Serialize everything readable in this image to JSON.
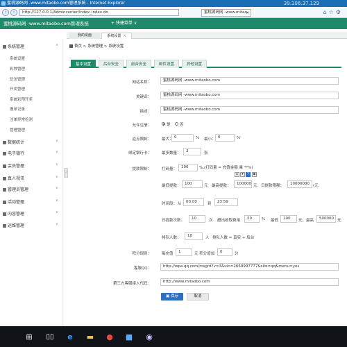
{
  "browser": {
    "title": "蜜桃源码网 -www.mitaobo.com管理系统 - Internet Explorer",
    "ip": "39.106.37.129",
    "address": "http://127.0.0.1/Admincenter/Index_index.do",
    "tab_label": "蜜桃源码网 -www.mitao..."
  },
  "header": {
    "title": "蜜桃源码网 -www.mitaobo.com管理系统",
    "quick_menu": "+ 快捷菜单 ∨"
  },
  "page_tabs": [
    {
      "label": "我的桌面"
    },
    {
      "label": "系统设置"
    }
  ],
  "sidebar": {
    "groups": [
      {
        "label": "系统管理",
        "items": [
          "系统设置",
          "彩种管理",
          "玩法管理",
          "开奖管理",
          "系统彩预开奖",
          "撤单记录",
          "注单异常检测",
          "管理管理"
        ]
      },
      {
        "label": "数据统计"
      },
      {
        "label": "电子银行"
      },
      {
        "label": "会员管理"
      },
      {
        "label": "真人视讯"
      },
      {
        "label": "管理员管理"
      },
      {
        "label": "活动管理"
      },
      {
        "label": "内容管理"
      },
      {
        "label": "运维管理"
      }
    ]
  },
  "breadcrumb": {
    "home": "首页",
    "sep": ">",
    "section": "系统管理",
    "page": "系统设置"
  },
  "content_tabs": [
    "基本设置",
    "后台安全",
    "前台安全",
    "邮件设置",
    "其他设置"
  ],
  "form": {
    "site_name": {
      "label": "网站名称：",
      "value": "蜜桃源码网 -www.mitaobo.com"
    },
    "keywords": {
      "label": "关键词：",
      "value": "蜜桃源码网 -www.mitaobo.com"
    },
    "description": {
      "label": "描述：",
      "value": "蜜桃源码网 -www.mitaobo.com"
    },
    "allow_register": {
      "label": "允许注册：",
      "yes": "是",
      "no": "否"
    },
    "rebate_limit": {
      "label": "返点限制：",
      "max_label": "最大：",
      "max": "0",
      "pct": "%",
      "min_label": "最小：",
      "min": "0"
    },
    "bind_card": {
      "label": "绑定银行卡：",
      "max_label": "最多数量：",
      "max": "3",
      "unit": "张"
    },
    "withdraw": {
      "label": "提款限制：",
      "bet_label": "打码量：",
      "bet": "100",
      "bet_note": "%,(打码量 = 充值金额 乘 **%)",
      "min_label": "最低提款：",
      "min": "100",
      "yuan": "元",
      "max_label": "最高提款：",
      "max": "100000",
      "daily_label": "日提款限额：",
      "daily": "10000000",
      "daily_unit": "(元",
      "time_label": "时间段：",
      "from": "从",
      "start": "00:00",
      "to": "到",
      "end": "23:59",
      "times_label": "日提款次数：",
      "times": "10",
      "times_unit": "次",
      "fee_label": "超出收取费用",
      "fee": "20",
      "fee_pct": "%",
      "fee_min_label": "最低",
      "fee_min": "100",
      "fee_max_label": "元，最高",
      "fee_max": "500000",
      "fee_max_unit": "元",
      "queue_label": "排队人数：",
      "queue": "10",
      "queue_unit": "人",
      "queue_note": "排队人数 = 真实 + 后台"
    },
    "points": {
      "label": "积分规则：",
      "per_label": "每充值",
      "per": "1",
      "mid": "元 积分增加",
      "points": "0",
      "unit": "分"
    },
    "qq": {
      "label": "客服QQ：",
      "value": "http://wpa.qq.com/msgrd?v=3&uin=2669997777&site=qq&menu=yes"
    },
    "third_party": {
      "label": "第三方客服接入代码：",
      "value": "http://www.mitaobo.com"
    },
    "save": "保存",
    "cancel": "取消"
  },
  "colors": {
    "brand": "#1f8a6a",
    "primary_button": "#2f6fc1",
    "ie_title": "#1a6fb4",
    "taskbar": "#101418"
  },
  "taskbar_icons": [
    "windows-start-icon",
    "search-icon",
    "task-view-icon",
    "ie-browser-icon",
    "folder-icon",
    "chrome-icon",
    "app-icon",
    "app-icon-2"
  ]
}
